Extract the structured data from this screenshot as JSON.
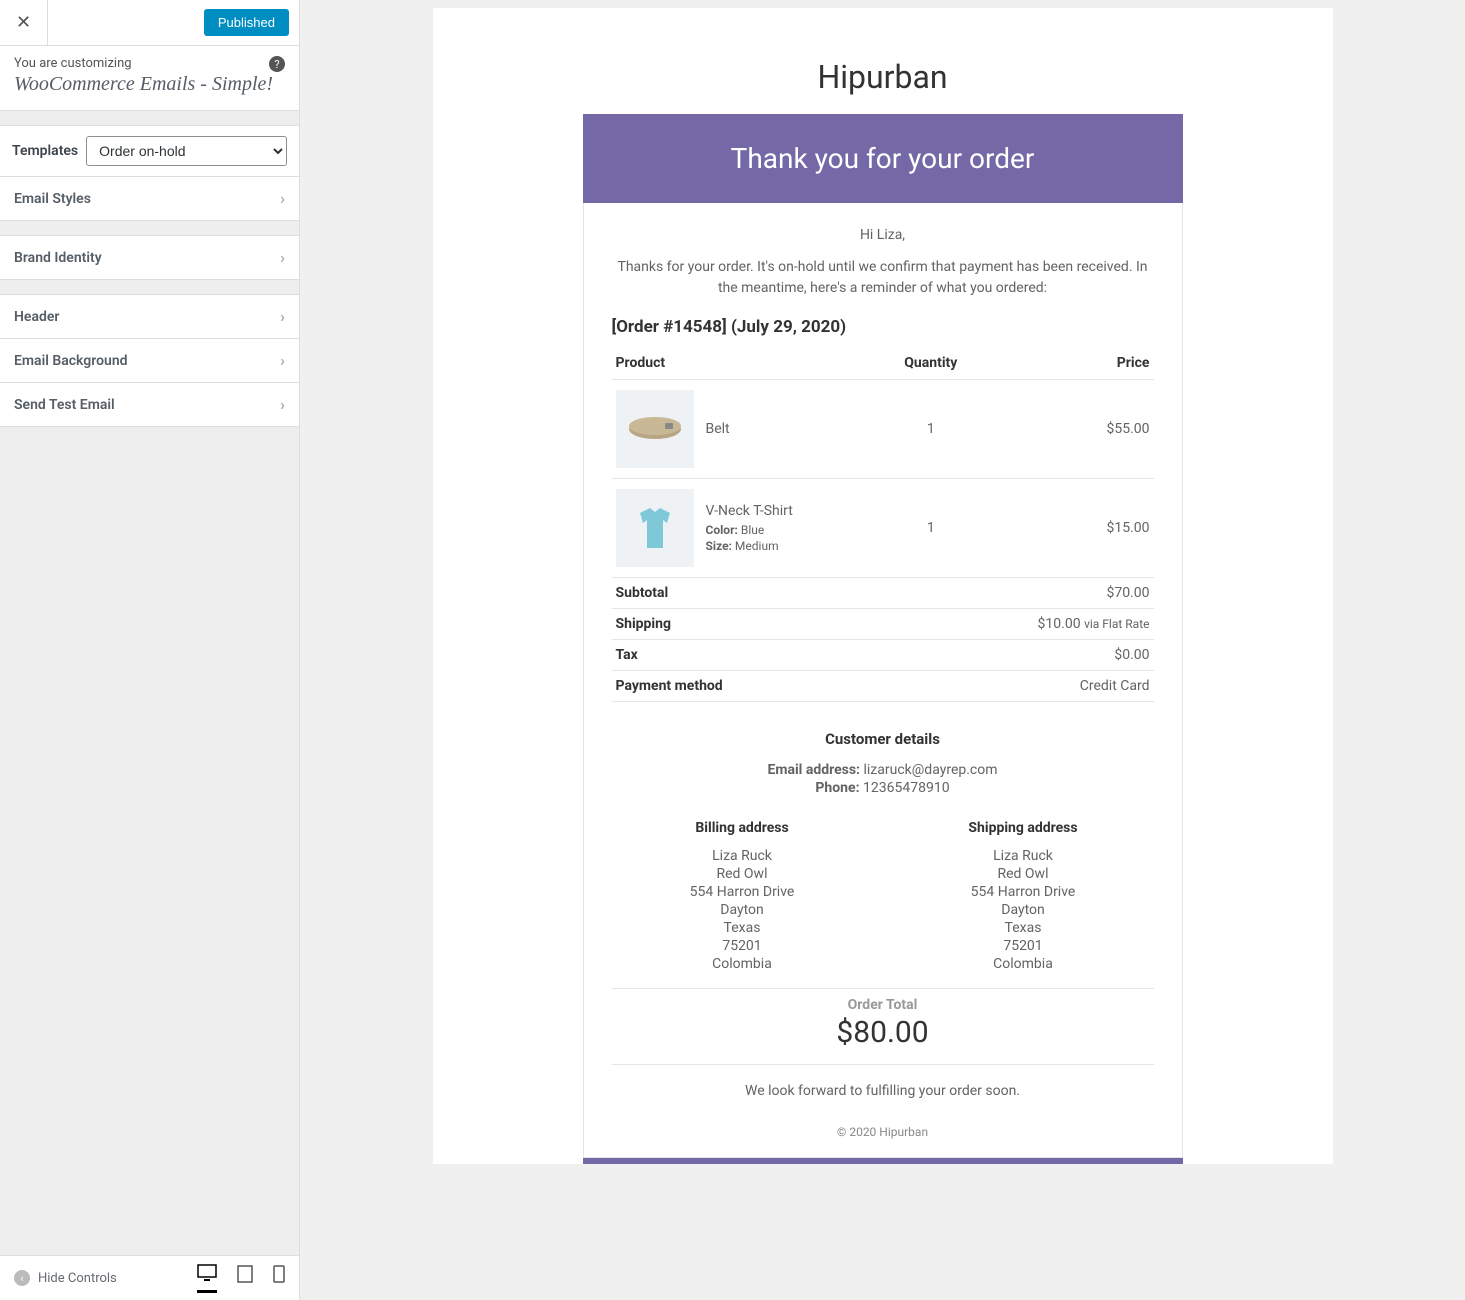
{
  "sidebar": {
    "published_label": "Published",
    "customizing_label": "You are customizing",
    "customizing_title": "WooCommerce Emails - Simple!",
    "templates_label": "Templates",
    "template_selected": "Order on-hold",
    "panels": {
      "email_styles": "Email Styles",
      "brand_identity": "Brand Identity",
      "header": "Header",
      "email_background": "Email Background",
      "send_test_email": "Send Test Email"
    },
    "hide_controls": "Hide Controls"
  },
  "email": {
    "brand": "Hipurban",
    "banner": "Thank you for your order",
    "greeting": "Hi Liza,",
    "intro": "Thanks for your order. It's on-hold until we confirm that payment has been received. In the meantime, here's a reminder of what you ordered:",
    "order_heading": "[Order #14548] (July 29, 2020)",
    "columns": {
      "product": "Product",
      "quantity": "Quantity",
      "price": "Price"
    },
    "items": [
      {
        "name": "Belt",
        "qty": "1",
        "price": "$55.00"
      },
      {
        "name": "V-Neck T-Shirt",
        "qty": "1",
        "price": "$15.00",
        "color_label": "Color:",
        "color": "Blue",
        "size_label": "Size:",
        "size": "Medium"
      }
    ],
    "totals": {
      "subtotal_label": "Subtotal",
      "subtotal": "$70.00",
      "shipping_label": "Shipping",
      "shipping": "$10.00",
      "shipping_note": "via Flat Rate",
      "tax_label": "Tax",
      "tax": "$0.00",
      "payment_label": "Payment method",
      "payment": "Credit Card"
    },
    "customer_details_heading": "Customer details",
    "email_label": "Email address:",
    "email_value": "lizaruck@dayrep.com",
    "phone_label": "Phone:",
    "phone_value": "12365478910",
    "billing_heading": "Billing address",
    "shipping_heading": "Shipping address",
    "address": [
      "Liza Ruck",
      "Red Owl",
      "554 Harron Drive",
      "Dayton",
      "Texas",
      "75201",
      "Colombia"
    ],
    "order_total_label": "Order Total",
    "order_total": "$80.00",
    "closing": "We look forward to fulfilling your order soon.",
    "copyright": "© 2020 Hipurban"
  }
}
